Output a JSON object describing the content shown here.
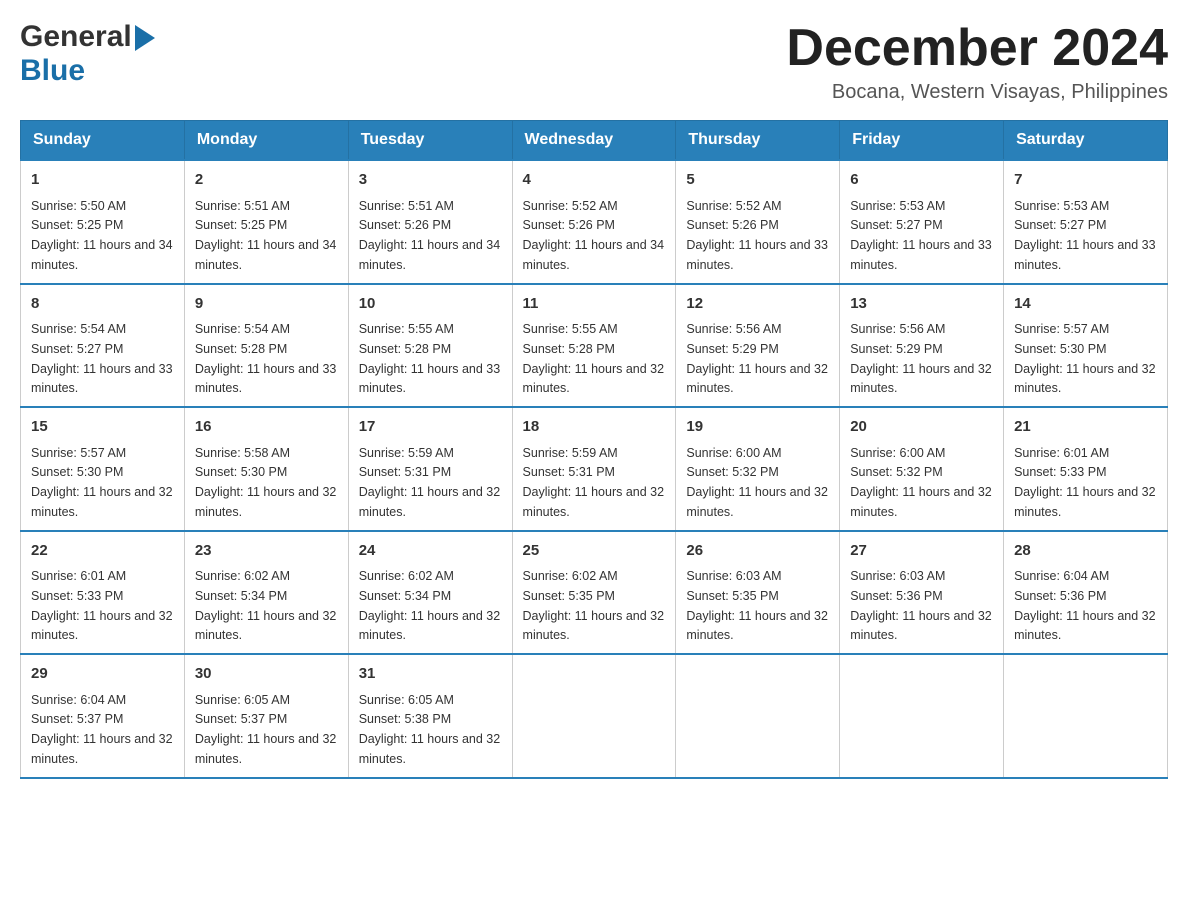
{
  "header": {
    "logo_general": "General",
    "logo_blue": "Blue",
    "month_title": "December 2024",
    "location": "Bocana, Western Visayas, Philippines"
  },
  "days_of_week": [
    "Sunday",
    "Monday",
    "Tuesday",
    "Wednesday",
    "Thursday",
    "Friday",
    "Saturday"
  ],
  "weeks": [
    [
      {
        "day": "1",
        "sunrise": "5:50 AM",
        "sunset": "5:25 PM",
        "daylight": "11 hours and 34 minutes."
      },
      {
        "day": "2",
        "sunrise": "5:51 AM",
        "sunset": "5:25 PM",
        "daylight": "11 hours and 34 minutes."
      },
      {
        "day": "3",
        "sunrise": "5:51 AM",
        "sunset": "5:26 PM",
        "daylight": "11 hours and 34 minutes."
      },
      {
        "day": "4",
        "sunrise": "5:52 AM",
        "sunset": "5:26 PM",
        "daylight": "11 hours and 34 minutes."
      },
      {
        "day": "5",
        "sunrise": "5:52 AM",
        "sunset": "5:26 PM",
        "daylight": "11 hours and 33 minutes."
      },
      {
        "day": "6",
        "sunrise": "5:53 AM",
        "sunset": "5:27 PM",
        "daylight": "11 hours and 33 minutes."
      },
      {
        "day": "7",
        "sunrise": "5:53 AM",
        "sunset": "5:27 PM",
        "daylight": "11 hours and 33 minutes."
      }
    ],
    [
      {
        "day": "8",
        "sunrise": "5:54 AM",
        "sunset": "5:27 PM",
        "daylight": "11 hours and 33 minutes."
      },
      {
        "day": "9",
        "sunrise": "5:54 AM",
        "sunset": "5:28 PM",
        "daylight": "11 hours and 33 minutes."
      },
      {
        "day": "10",
        "sunrise": "5:55 AM",
        "sunset": "5:28 PM",
        "daylight": "11 hours and 33 minutes."
      },
      {
        "day": "11",
        "sunrise": "5:55 AM",
        "sunset": "5:28 PM",
        "daylight": "11 hours and 32 minutes."
      },
      {
        "day": "12",
        "sunrise": "5:56 AM",
        "sunset": "5:29 PM",
        "daylight": "11 hours and 32 minutes."
      },
      {
        "day": "13",
        "sunrise": "5:56 AM",
        "sunset": "5:29 PM",
        "daylight": "11 hours and 32 minutes."
      },
      {
        "day": "14",
        "sunrise": "5:57 AM",
        "sunset": "5:30 PM",
        "daylight": "11 hours and 32 minutes."
      }
    ],
    [
      {
        "day": "15",
        "sunrise": "5:57 AM",
        "sunset": "5:30 PM",
        "daylight": "11 hours and 32 minutes."
      },
      {
        "day": "16",
        "sunrise": "5:58 AM",
        "sunset": "5:30 PM",
        "daylight": "11 hours and 32 minutes."
      },
      {
        "day": "17",
        "sunrise": "5:59 AM",
        "sunset": "5:31 PM",
        "daylight": "11 hours and 32 minutes."
      },
      {
        "day": "18",
        "sunrise": "5:59 AM",
        "sunset": "5:31 PM",
        "daylight": "11 hours and 32 minutes."
      },
      {
        "day": "19",
        "sunrise": "6:00 AM",
        "sunset": "5:32 PM",
        "daylight": "11 hours and 32 minutes."
      },
      {
        "day": "20",
        "sunrise": "6:00 AM",
        "sunset": "5:32 PM",
        "daylight": "11 hours and 32 minutes."
      },
      {
        "day": "21",
        "sunrise": "6:01 AM",
        "sunset": "5:33 PM",
        "daylight": "11 hours and 32 minutes."
      }
    ],
    [
      {
        "day": "22",
        "sunrise": "6:01 AM",
        "sunset": "5:33 PM",
        "daylight": "11 hours and 32 minutes."
      },
      {
        "day": "23",
        "sunrise": "6:02 AM",
        "sunset": "5:34 PM",
        "daylight": "11 hours and 32 minutes."
      },
      {
        "day": "24",
        "sunrise": "6:02 AM",
        "sunset": "5:34 PM",
        "daylight": "11 hours and 32 minutes."
      },
      {
        "day": "25",
        "sunrise": "6:02 AM",
        "sunset": "5:35 PM",
        "daylight": "11 hours and 32 minutes."
      },
      {
        "day": "26",
        "sunrise": "6:03 AM",
        "sunset": "5:35 PM",
        "daylight": "11 hours and 32 minutes."
      },
      {
        "day": "27",
        "sunrise": "6:03 AM",
        "sunset": "5:36 PM",
        "daylight": "11 hours and 32 minutes."
      },
      {
        "day": "28",
        "sunrise": "6:04 AM",
        "sunset": "5:36 PM",
        "daylight": "11 hours and 32 minutes."
      }
    ],
    [
      {
        "day": "29",
        "sunrise": "6:04 AM",
        "sunset": "5:37 PM",
        "daylight": "11 hours and 32 minutes."
      },
      {
        "day": "30",
        "sunrise": "6:05 AM",
        "sunset": "5:37 PM",
        "daylight": "11 hours and 32 minutes."
      },
      {
        "day": "31",
        "sunrise": "6:05 AM",
        "sunset": "5:38 PM",
        "daylight": "11 hours and 32 minutes."
      },
      null,
      null,
      null,
      null
    ]
  ],
  "labels": {
    "sunrise_prefix": "Sunrise: ",
    "sunset_prefix": "Sunset: ",
    "daylight_prefix": "Daylight: "
  }
}
